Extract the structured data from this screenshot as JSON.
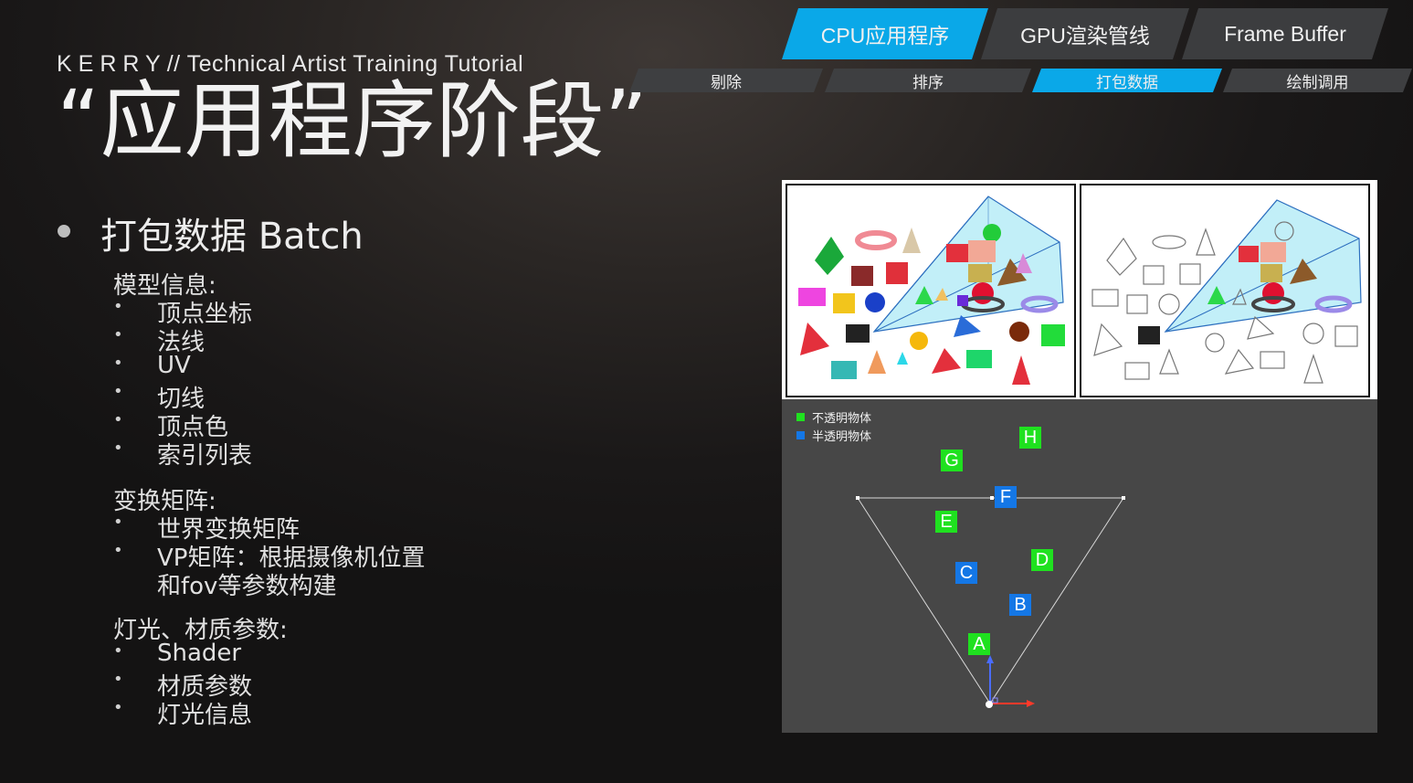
{
  "brand": {
    "name": "KERRY",
    "rest": "// Technical Artist Training Tutorial"
  },
  "page_title": "“应用程序阶段”",
  "tabs": [
    {
      "label": "CPU应用程序",
      "active": true
    },
    {
      "label": "GPU渲染管线",
      "active": false
    },
    {
      "label": "Frame Buffer",
      "active": false
    }
  ],
  "subtabs": [
    {
      "label": "剔除",
      "active": false
    },
    {
      "label": "排序",
      "active": false
    },
    {
      "label": "打包数据",
      "active": true
    },
    {
      "label": "绘制调用",
      "active": false
    }
  ],
  "heading": "打包数据 Batch",
  "sections": {
    "model": {
      "title": "模型信息:",
      "items": [
        "顶点坐标",
        "法线",
        "UV",
        "切线",
        "顶点色",
        "索引列表"
      ]
    },
    "transform": {
      "title": "变换矩阵:",
      "items": [
        "世界变换矩阵",
        "VP矩阵：根据摄像机位置",
        "和fov等参数构建"
      ]
    },
    "light": {
      "title": "灯光、材质参数:",
      "items": [
        "Shader",
        "材质参数",
        "灯光信息"
      ]
    }
  },
  "legend": [
    {
      "label": "不透明物体",
      "color": "#1fe11f"
    },
    {
      "label": "半透明物体",
      "color": "#1477e6"
    }
  ],
  "markers": [
    {
      "label": "H",
      "type": "opaque"
    },
    {
      "label": "G",
      "type": "opaque"
    },
    {
      "label": "F",
      "type": "transparent"
    },
    {
      "label": "E",
      "type": "opaque"
    },
    {
      "label": "D",
      "type": "opaque"
    },
    {
      "label": "C",
      "type": "transparent"
    },
    {
      "label": "B",
      "type": "transparent"
    },
    {
      "label": "A",
      "type": "opaque"
    }
  ],
  "colors": {
    "accent": "#0aa8e8",
    "tab_inactive": "#3c3d3f",
    "opaque": "#1fe11f",
    "transparent": "#1477e6"
  }
}
